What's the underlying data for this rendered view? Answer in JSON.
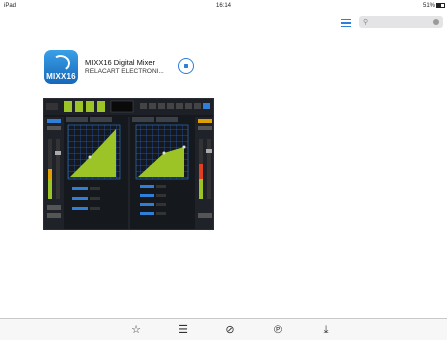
{
  "status_bar": {
    "carrier": "iPad",
    "time": "16:14",
    "battery": "51%"
  },
  "search": {
    "placeholder": "",
    "value": ""
  },
  "app": {
    "name": "MIXX16 Digital Mixer",
    "developer": "RELACART ELECTRONI...",
    "icon_text": "MIXX16"
  },
  "tabs": [
    {
      "name": "featured",
      "icon": "star-icon"
    },
    {
      "name": "lists",
      "icon": "list-icon"
    },
    {
      "name": "not-found",
      "icon": "no-entry-icon"
    },
    {
      "name": "purchased",
      "icon": "purchased-icon"
    },
    {
      "name": "updates",
      "icon": "download-icon"
    }
  ],
  "colors": {
    "accent": "#2f7fd8",
    "screenshot_bg": "#15181d",
    "eq_fill": "#9cc427",
    "eq_grid": "#1b5fd0"
  }
}
